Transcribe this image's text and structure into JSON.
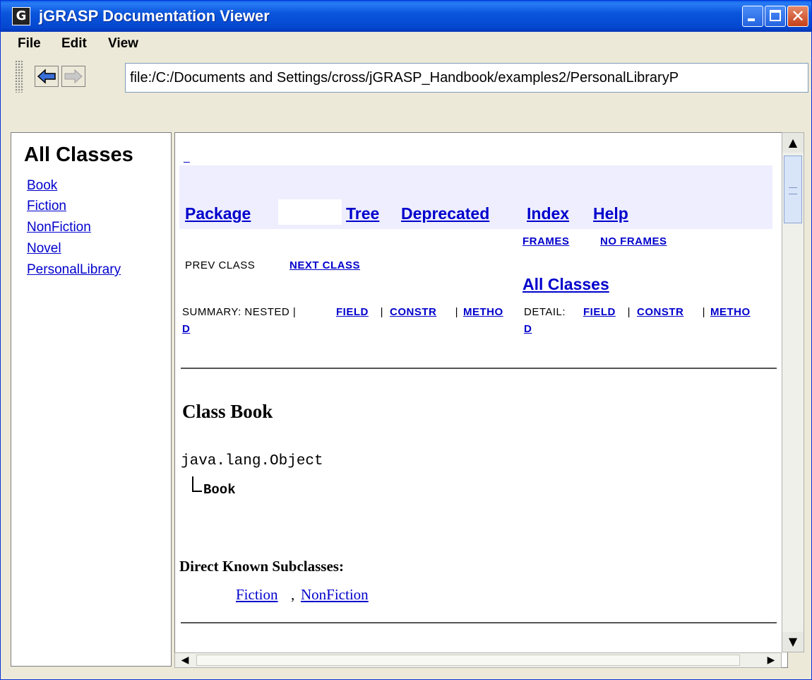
{
  "window": {
    "title": "jGRASP Documentation Viewer",
    "app_icon": "G"
  },
  "menu": {
    "items": [
      "File",
      "Edit",
      "View"
    ]
  },
  "toolbar": {
    "address": "file:/C:/Documents and Settings/cross/jGRASP_Handbook/examples2/PersonalLibraryP"
  },
  "left": {
    "heading": "All Classes",
    "classes": [
      "Book",
      "Fiction",
      "NonFiction",
      "Novel",
      "PersonalLibrary"
    ]
  },
  "main": {
    "top_link": "_",
    "nav": {
      "package": "Package",
      "tree": "Tree",
      "deprecated": "Deprecated",
      "index": "Index",
      "help": "Help"
    },
    "frames": "FRAMES",
    "no_frames": "NO FRAMES",
    "prev_class": "PREV CLASS",
    "next_class": "NEXT CLASS",
    "all_classes": "All Classes",
    "summary_label": "SUMMARY: NESTED | ",
    "summary_field": "FIELD",
    "summary_sep1": " | ",
    "summary_constr": "CONSTR",
    "summary_sep2": " | ",
    "summary_metho": "METHO",
    "summary_d": "D",
    "detail_label": "DETAIL: ",
    "detail_field": "FIELD",
    "detail_sep1": " | ",
    "detail_constr": "CONSTR",
    "detail_sep2": " | ",
    "detail_metho": "METHO",
    "detail_d": "D",
    "class_title": "Class Book",
    "superclass": "java.lang.Object",
    "class_leaf": "Book",
    "subclasses_heading": "Direct Known Subclasses:",
    "subclass_1": "Fiction",
    "subclass_sep": ", ",
    "subclass_2": "NonFiction"
  }
}
